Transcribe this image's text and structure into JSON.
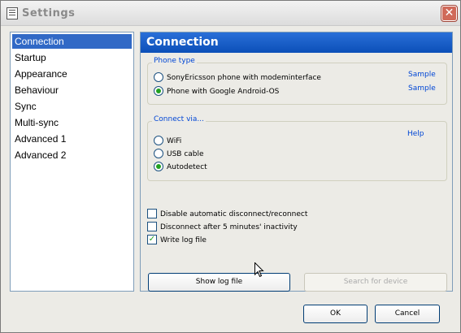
{
  "window": {
    "title": "Settings",
    "close_label": "✕"
  },
  "nav": {
    "items": [
      "Connection",
      "Startup",
      "Appearance",
      "Behaviour",
      "Sync",
      "Multi-sync",
      "Advanced 1",
      "Advanced 2"
    ],
    "selected": "Connection"
  },
  "panel": {
    "title": "Connection",
    "phone_type": {
      "title": "Phone type",
      "options": [
        {
          "label": "SonyEricsson phone with modeminterface",
          "selected": false,
          "link": "Sample"
        },
        {
          "label": "Phone with Google Android-OS",
          "selected": true,
          "link": "Sample"
        }
      ]
    },
    "connect_via": {
      "title": "Connect via...",
      "help_label": "Help",
      "options": [
        {
          "label": "WiFi",
          "selected": false
        },
        {
          "label": "USB cable",
          "selected": false
        },
        {
          "label": "Autodetect",
          "selected": true
        }
      ]
    },
    "checkboxes": [
      {
        "label": "Disable automatic disconnect/reconnect",
        "checked": false
      },
      {
        "label": "Disconnect after 5 minutes' inactivity",
        "checked": false
      },
      {
        "label": "Write log file",
        "checked": true
      }
    ],
    "show_log_label": "Show log file",
    "search_device_label": "Search for device"
  },
  "footer": {
    "ok_label": "OK",
    "cancel_label": "Cancel"
  }
}
